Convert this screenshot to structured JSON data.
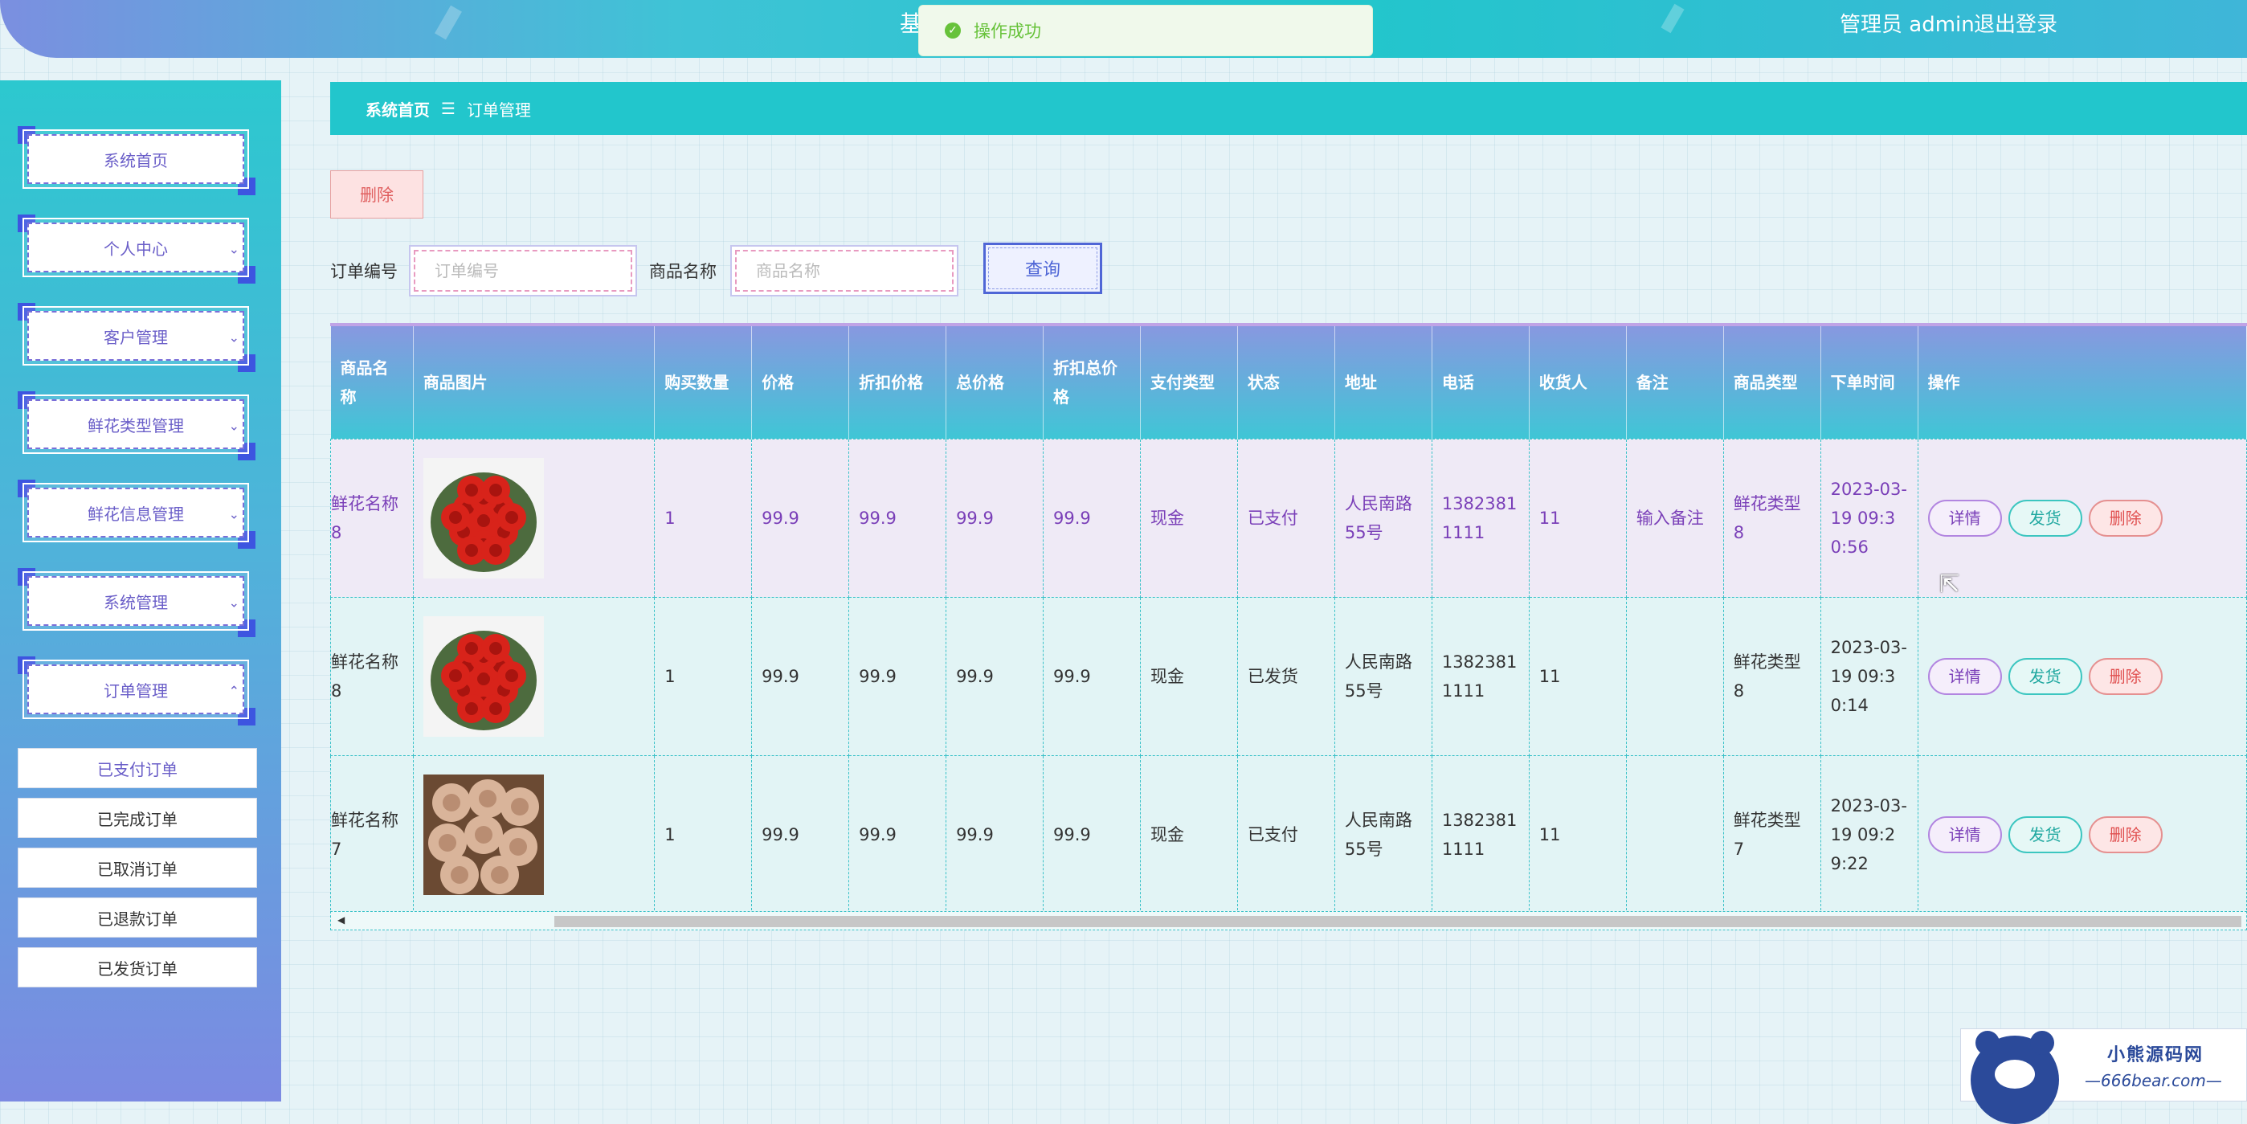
{
  "header": {
    "title_fragment": "基",
    "user_label": "管理员 admin",
    "logout_label": "退出登录"
  },
  "toast": {
    "message": "操作成功"
  },
  "sidebar": {
    "items": [
      {
        "label": "系统首页"
      },
      {
        "label": "个人中心"
      },
      {
        "label": "客户管理"
      },
      {
        "label": "鲜花类型管理"
      },
      {
        "label": "鲜花信息管理"
      },
      {
        "label": "系统管理"
      },
      {
        "label": "订单管理"
      }
    ],
    "submenu": [
      {
        "label": "已支付订单"
      },
      {
        "label": "已完成订单"
      },
      {
        "label": "已取消订单"
      },
      {
        "label": "已退款订单"
      },
      {
        "label": "已发货订单"
      }
    ]
  },
  "breadcrumb": {
    "home": "系统首页",
    "separator": "☰",
    "current": "订单管理"
  },
  "toolbar": {
    "delete_label": "删除"
  },
  "search": {
    "order_no_label": "订单编号",
    "order_no_placeholder": "订单编号",
    "product_name_label": "商品名称",
    "product_name_placeholder": "商品名称",
    "query_label": "查询"
  },
  "table": {
    "columns": [
      "商品名称",
      "商品图片",
      "购买数量",
      "价格",
      "折扣价格",
      "总价格",
      "折扣总价格",
      "支付类型",
      "状态",
      "地址",
      "电话",
      "收货人",
      "备注",
      "商品类型",
      "下单时间",
      "操作"
    ],
    "action_labels": {
      "detail": "详情",
      "ship": "发货",
      "delete": "删除"
    },
    "rows": [
      {
        "name": "鲜花名称8",
        "image": "red-roses",
        "qty": "1",
        "price": "99.9",
        "discount_price": "99.9",
        "total": "99.9",
        "discount_total": "99.9",
        "pay_type": "现金",
        "status": "已支付",
        "address": "人民南路55号",
        "phone": "13823811111",
        "receiver": "11",
        "remark": "输入备注",
        "category": "鲜花类型8",
        "time": "2023-03-19 09:30:56"
      },
      {
        "name": "鲜花名称8",
        "image": "red-roses",
        "qty": "1",
        "price": "99.9",
        "discount_price": "99.9",
        "total": "99.9",
        "discount_total": "99.9",
        "pay_type": "现金",
        "status": "已发货",
        "address": "人民南路55号",
        "phone": "13823811111",
        "receiver": "11",
        "remark": "",
        "category": "鲜花类型8",
        "time": "2023-03-19 09:30:14"
      },
      {
        "name": "鲜花名称7",
        "image": "champagne-roses",
        "qty": "1",
        "price": "99.9",
        "discount_price": "99.9",
        "total": "99.9",
        "discount_total": "99.9",
        "pay_type": "现金",
        "status": "已支付",
        "address": "人民南路55号",
        "phone": "13823811111",
        "receiver": "11",
        "remark": "",
        "category": "鲜花类型7",
        "time": "2023-03-19 09:29:22"
      }
    ]
  },
  "watermark": {
    "title": "小熊源码网",
    "url": "—666bear.com—"
  },
  "colors": {
    "accent": "#22c6cc",
    "menu_text": "#6a5ec8",
    "success": "#67c23a",
    "danger": "#e05050"
  }
}
